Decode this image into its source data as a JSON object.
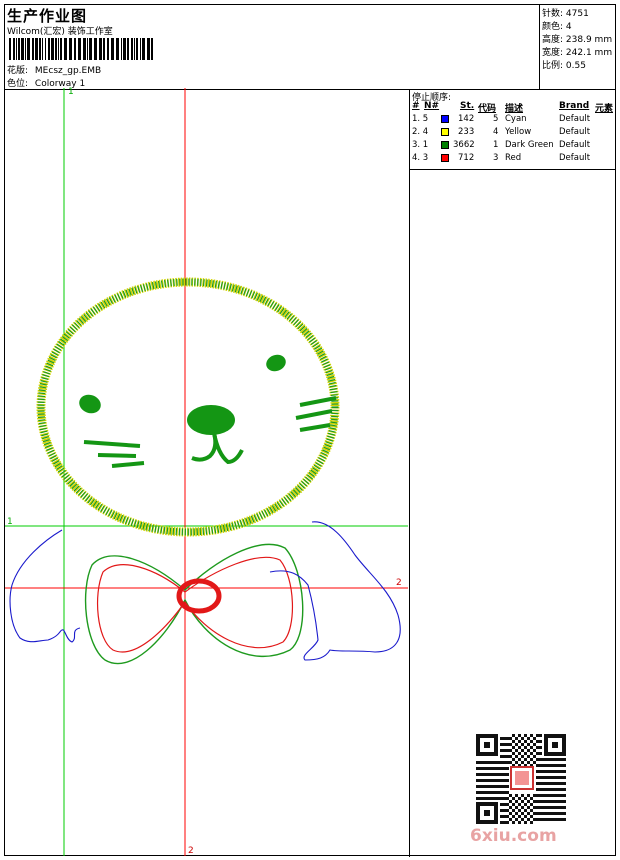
{
  "header": {
    "title": "生产作业图",
    "company": "Wilcom(汇宏) 装饰工作室",
    "design_label": "花版:",
    "design_value": "MEcsz_gp.EMB",
    "colorway_label": "色位:",
    "colorway_value": "Colorway 1"
  },
  "stats": [
    {
      "label": "针数:",
      "value": "4751"
    },
    {
      "label": "颜色:",
      "value": "4"
    },
    {
      "label": "高度:",
      "value": "238.9 mm"
    },
    {
      "label": "宽度:",
      "value": "242.1 mm"
    },
    {
      "label": "比例:",
      "value": "0.55"
    }
  ],
  "stop_order": {
    "title": "停止顺序:",
    "headers": {
      "num": "#",
      "n": "N#",
      "st": "St.",
      "code": "代码",
      "desc": "描述",
      "brand": "Brand",
      "elem": "元素"
    },
    "rows": [
      {
        "num": "1. 5",
        "color": "#0000ff",
        "st": "142",
        "code": "5",
        "desc": "Cyan",
        "brand": "Default"
      },
      {
        "num": "2. 4",
        "color": "#ffff00",
        "st": "233",
        "code": "4",
        "desc": "Yellow",
        "brand": "Default"
      },
      {
        "num": "3. 1",
        "color": "#008000",
        "st": "3662",
        "code": "1",
        "desc": "Dark Green",
        "brand": "Default"
      },
      {
        "num": "4. 3",
        "color": "#ff0000",
        "st": "712",
        "code": "3",
        "desc": "Red",
        "brand": "Default"
      }
    ]
  },
  "axes": {
    "green_v": "1",
    "green_h": "1",
    "red_h": "2",
    "red_v": "2"
  },
  "watermark": "6xiu.com"
}
